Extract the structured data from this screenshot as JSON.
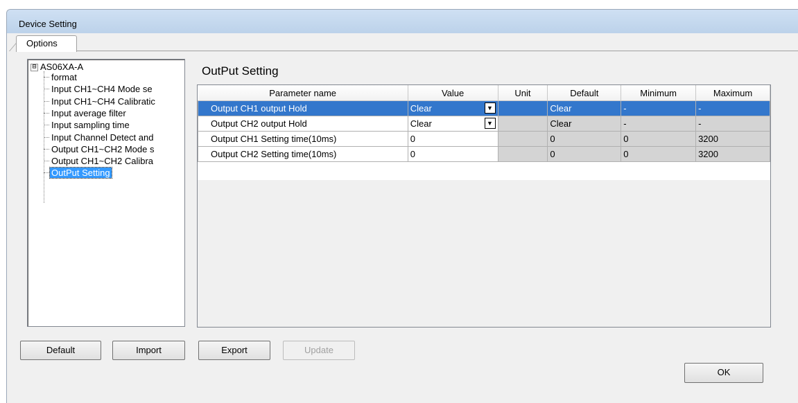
{
  "window": {
    "title": "Device Setting"
  },
  "tabs": [
    {
      "label": "Options"
    }
  ],
  "tree": {
    "root": {
      "toggle": "⊟",
      "label": "AS06XA-A"
    },
    "items": [
      {
        "label": "format",
        "selected": false
      },
      {
        "label": "Input CH1~CH4 Mode se",
        "selected": false
      },
      {
        "label": "Input CH1~CH4 Calibratic",
        "selected": false
      },
      {
        "label": "Input average filter",
        "selected": false
      },
      {
        "label": "Input sampling time",
        "selected": false
      },
      {
        "label": "Input Channel Detect and",
        "selected": false
      },
      {
        "label": "Output CH1~CH2 Mode s",
        "selected": false
      },
      {
        "label": "Output CH1~CH2 Calibra",
        "selected": false
      },
      {
        "label": "OutPut Setting",
        "selected": true
      }
    ]
  },
  "section": {
    "title": "OutPut Setting"
  },
  "grid": {
    "columns": [
      "Parameter name",
      "Value",
      "Unit",
      "Default",
      "Minimum",
      "Maximum"
    ],
    "rows": [
      {
        "name": "Output CH1 output Hold",
        "value": "Clear",
        "unit": "",
        "default": "Clear",
        "minimum": "-",
        "maximum": "-",
        "combo": true,
        "selected": true
      },
      {
        "name": "Output CH2 output Hold",
        "value": "Clear",
        "unit": "",
        "default": "Clear",
        "minimum": "-",
        "maximum": "-",
        "combo": true,
        "selected": false
      },
      {
        "name": "Output CH1 Setting time(10ms)",
        "value": "0",
        "unit": "",
        "default": "0",
        "minimum": "0",
        "maximum": "3200",
        "combo": false,
        "selected": false
      },
      {
        "name": "Output CH2 Setting time(10ms)",
        "value": "0",
        "unit": "",
        "default": "0",
        "minimum": "0",
        "maximum": "3200",
        "combo": false,
        "selected": false
      }
    ]
  },
  "buttons": {
    "default": "Default",
    "import": "Import",
    "export": "Export",
    "update": "Update",
    "ok": "OK"
  },
  "colors": {
    "selection": "#3377cc",
    "tree_selection": "#3399ff",
    "titlebar": "#c4d7ee"
  }
}
